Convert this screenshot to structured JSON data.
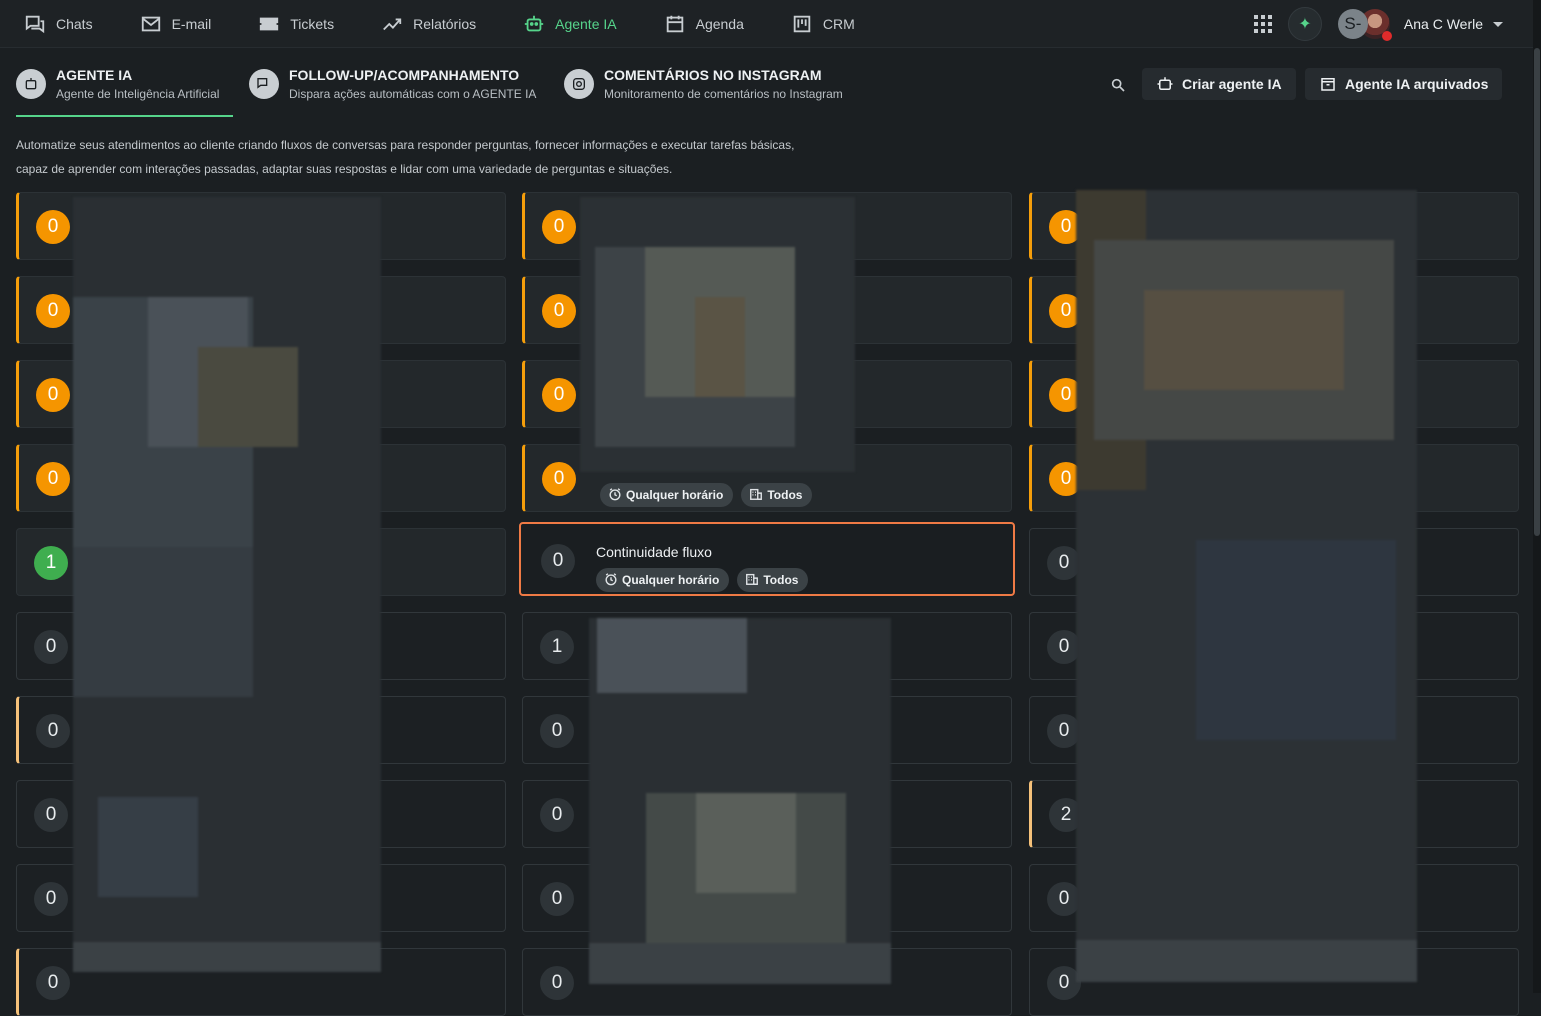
{
  "nav": {
    "items": [
      {
        "label": "Chats",
        "icon": "chat-icon"
      },
      {
        "label": "E-mail",
        "icon": "mail-icon"
      },
      {
        "label": "Tickets",
        "icon": "ticket-icon"
      },
      {
        "label": "Relatórios",
        "icon": "chart-line-icon"
      },
      {
        "label": "Agente IA",
        "icon": "robot-icon",
        "active": true
      },
      {
        "label": "Agenda",
        "icon": "calendar-icon"
      },
      {
        "label": "CRM",
        "icon": "kanban-icon"
      }
    ],
    "user": {
      "initial": "S-",
      "name": "Ana C Werle"
    }
  },
  "tabs": [
    {
      "title": "AGENTE IA",
      "subtitle": "Agente de Inteligência Artificial",
      "active": true
    },
    {
      "title": "FOLLOW-UP/ACOMPANHAMENTO",
      "subtitle": "Dispara ações automáticas com o AGENTE IA"
    },
    {
      "title": "COMENTÁRIOS NO INSTAGRAM",
      "subtitle": "Monitoramento de comentários no Instagram"
    }
  ],
  "actions": {
    "create_label": "Criar agente IA",
    "archived_label": "Agente IA arquivados"
  },
  "description": {
    "line1": "Automatize seus atendimentos ao cliente criando fluxos de conversas para responder perguntas, fornecer informações e executar tarefas básicas,",
    "line2": "capaz de aprender com interações passadas, adaptar suas respostas e lidar com uma variedade de perguntas e situações."
  },
  "chip_labels": {
    "schedule": "Qualquer horário",
    "dept": "Todos"
  },
  "columns": [
    {
      "cards": [
        {
          "count": "0",
          "badge": "orange"
        },
        {
          "count": "0",
          "badge": "orange"
        },
        {
          "count": "0",
          "badge": "orange"
        },
        {
          "count": "0",
          "badge": "orange"
        },
        {
          "count": "1",
          "badge": "green"
        },
        {
          "count": "0",
          "badge": "gray"
        },
        {
          "count": "0",
          "badge": "gray"
        },
        {
          "count": "0",
          "badge": "gray"
        },
        {
          "count": "0",
          "badge": "gray"
        },
        {
          "count": "0",
          "badge": "gray"
        }
      ]
    },
    {
      "cards": [
        {
          "count": "0",
          "badge": "orange"
        },
        {
          "count": "0",
          "badge": "orange"
        },
        {
          "count": "0",
          "badge": "orange"
        },
        {
          "count": "0",
          "badge": "orange"
        },
        {
          "count": "0",
          "badge": "gray",
          "title": "Continuidade fluxo",
          "highlighted": true
        },
        {
          "count": "1",
          "badge": "gray"
        },
        {
          "count": "0",
          "badge": "gray"
        },
        {
          "count": "0",
          "badge": "gray"
        },
        {
          "count": "0",
          "badge": "gray"
        },
        {
          "count": "0",
          "badge": "gray"
        }
      ]
    },
    {
      "cards": [
        {
          "count": "0",
          "badge": "orange"
        },
        {
          "count": "0",
          "badge": "orange"
        },
        {
          "count": "0",
          "badge": "orange"
        },
        {
          "count": "0",
          "badge": "orange"
        },
        {
          "count": "0",
          "badge": "gray"
        },
        {
          "count": "0",
          "badge": "gray"
        },
        {
          "count": "0",
          "badge": "gray"
        },
        {
          "count": "2",
          "badge": "gray"
        },
        {
          "count": "0",
          "badge": "gray"
        },
        {
          "count": "0",
          "badge": "gray"
        }
      ]
    }
  ],
  "colors": {
    "accent": "#56d48b",
    "orange": "#f59500",
    "highlight": "#ef7a45",
    "green": "#3fae4f"
  }
}
